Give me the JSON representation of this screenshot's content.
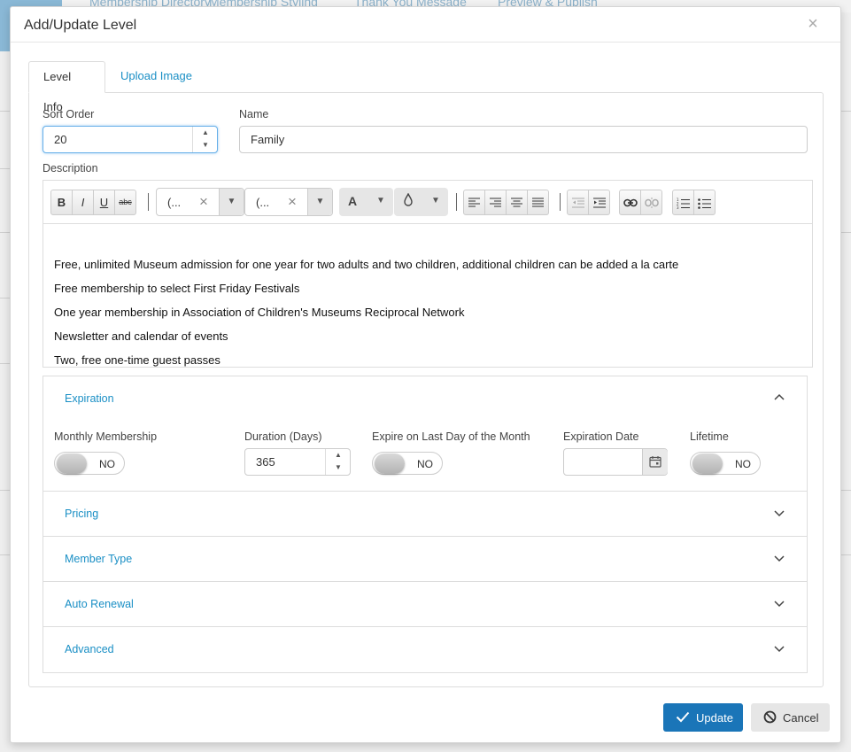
{
  "background": {
    "tabs": [
      "Membership Directory",
      "Membership Styling",
      "Thank You Message",
      "Preview & Publish"
    ]
  },
  "modal": {
    "title": "Add/Update Level",
    "close_label": "×"
  },
  "tabs": [
    {
      "label": "Level Info",
      "active": true
    },
    {
      "label": "Upload Image",
      "active": false
    }
  ],
  "form": {
    "sort_order": {
      "label": "Sort Order",
      "value": "20"
    },
    "name": {
      "label": "Name",
      "value": "Family"
    },
    "description_label": "Description"
  },
  "toolbar": {
    "bold": "B",
    "italic": "I",
    "underline": "U",
    "strike": "abc",
    "font_name": "(...",
    "font_size": "(...",
    "font_color_glyph": "A",
    "clear_glyph": "×"
  },
  "description_lines": [
    "Free, unlimited Museum admission for one year for two adults and two children, additional children can be added a la carte",
    "Free membership to select First Friday Festivals",
    "One year membership in Association of Children's Museums Reciprocal Network",
    "Newsletter and calendar of events",
    "Two, free one-time guest passes"
  ],
  "expiration": {
    "title": "Expiration",
    "monthly_label": "Monthly Membership",
    "monthly_state": "NO",
    "duration_label": "Duration (Days)",
    "duration_value": "365",
    "expire_last_day_label": "Expire on Last Day of the Month",
    "expire_last_day_state": "NO",
    "expiration_date_label": "Expiration Date",
    "expiration_date_value": "",
    "lifetime_label": "Lifetime",
    "lifetime_state": "NO"
  },
  "sections": [
    {
      "title": "Pricing"
    },
    {
      "title": "Member Type"
    },
    {
      "title": "Auto Renewal"
    },
    {
      "title": "Advanced"
    }
  ],
  "footer": {
    "update_label": "Update",
    "cancel_label": "Cancel"
  },
  "colors": {
    "link": "#1a8fc5",
    "primary_button": "#1a75b8"
  }
}
